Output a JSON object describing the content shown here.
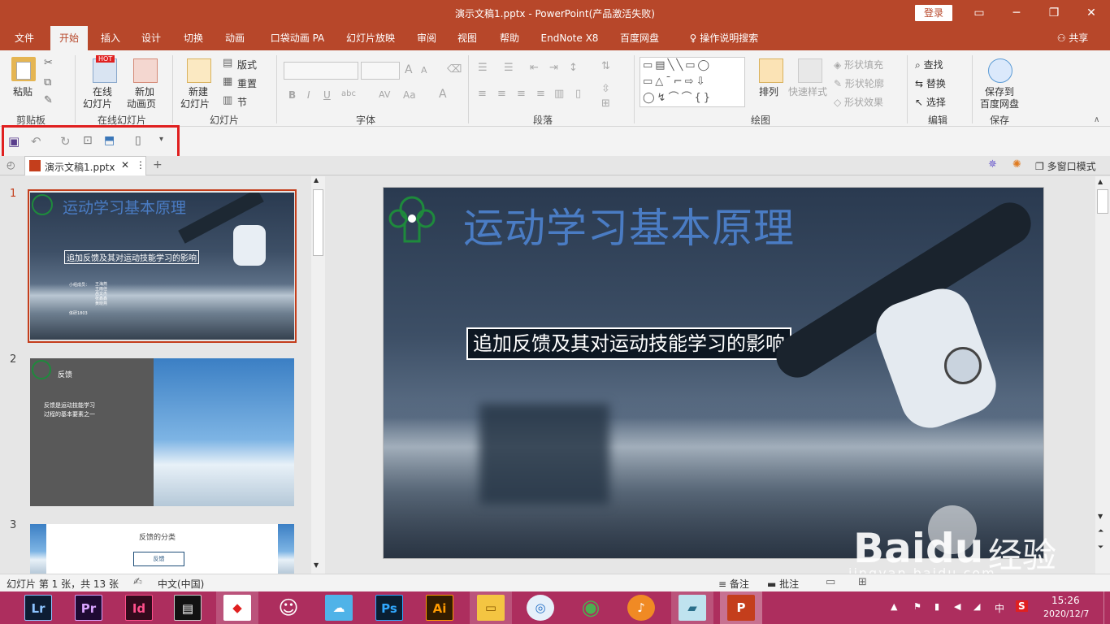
{
  "window": {
    "title": "演示文稿1.pptx  -  PowerPoint(产品激活失败)",
    "login": "登录",
    "minimize": "─",
    "restore": "❐",
    "close": "✕"
  },
  "tabs": [
    "文件",
    "开始",
    "插入",
    "设计",
    "切换",
    "动画",
    "口袋动画 PA",
    "幻灯片放映",
    "审阅",
    "视图",
    "帮助",
    "EndNote X8",
    "百度网盘"
  ],
  "tell_me": "操作说明搜索",
  "share": "共享",
  "ribbon": {
    "clipboard": {
      "paste": "粘贴",
      "label": "剪贴板"
    },
    "online": {
      "online_slides_1": "在线",
      "online_slides_2": "幻灯片",
      "new_anim_1": "新加",
      "new_anim_2": "动画页",
      "hot": "HOT",
      "label": "在线幻灯片"
    },
    "slides": {
      "new_slide_1": "新建",
      "new_slide_2": "幻灯片",
      "layout": "版式",
      "reset": "重置",
      "section": "节",
      "label": "幻灯片"
    },
    "font": {
      "label": "字体",
      "bold": "B",
      "italic": "I",
      "underline": "U",
      "strike": "abc",
      "spacing": "AV",
      "case": "Aa",
      "grow": "A",
      "shrink": "A",
      "color": "A"
    },
    "paragraph": {
      "label": "段落"
    },
    "drawing": {
      "arrange": "排列",
      "quick_styles": "快速样式",
      "fill": "形状填充",
      "outline": "形状轮廓",
      "effect": "形状效果",
      "label": "绘图"
    },
    "editing": {
      "find": "查找",
      "replace": "替换",
      "select": "选择",
      "label": "编辑"
    },
    "save": {
      "save_to_1": "保存到",
      "save_to_2": "百度网盘",
      "label": "保存"
    }
  },
  "file_tab": {
    "name": "演示文稿1.pptx",
    "multi_window": "多窗口模式"
  },
  "slides": [
    {
      "num": "1",
      "title": "运动学习基本原理",
      "subtitle": "追加反馈及其对运动技能学习的影响",
      "members_label": "小组成员：",
      "members": [
        "王海燕",
        "王雨佳",
        "岳文杰",
        "张鑫鑫",
        "黄晓燕"
      ],
      "class": "体研1803"
    },
    {
      "num": "2",
      "title": "反馈",
      "body_1": "反馈是运动技能学习",
      "body_2": "过程的基本要素之一"
    },
    {
      "num": "3",
      "title": "反馈的分类",
      "box": "反馈"
    }
  ],
  "main_slide": {
    "title": "运动学习基本原理",
    "subtitle": "追加反馈及其对运动技能学习的影响"
  },
  "status": {
    "slide_info": "幻灯片 第 1 张，共 13 张",
    "language": "中文(中国)",
    "notes": "备注",
    "comments": "批注"
  },
  "watermark": {
    "text": "Bai",
    "text2": "du",
    "cn": "经验",
    "url": "jingyan.baidu.com"
  },
  "taskbar": {
    "apps": [
      "Lr",
      "Pr",
      "Id",
      "",
      "",
      "",
      "",
      "Ps",
      "Ai",
      "",
      "",
      "",
      "",
      "",
      ""
    ],
    "time": "15:26",
    "date": "2020/12/7",
    "ime": "中",
    "ime2": "S"
  }
}
